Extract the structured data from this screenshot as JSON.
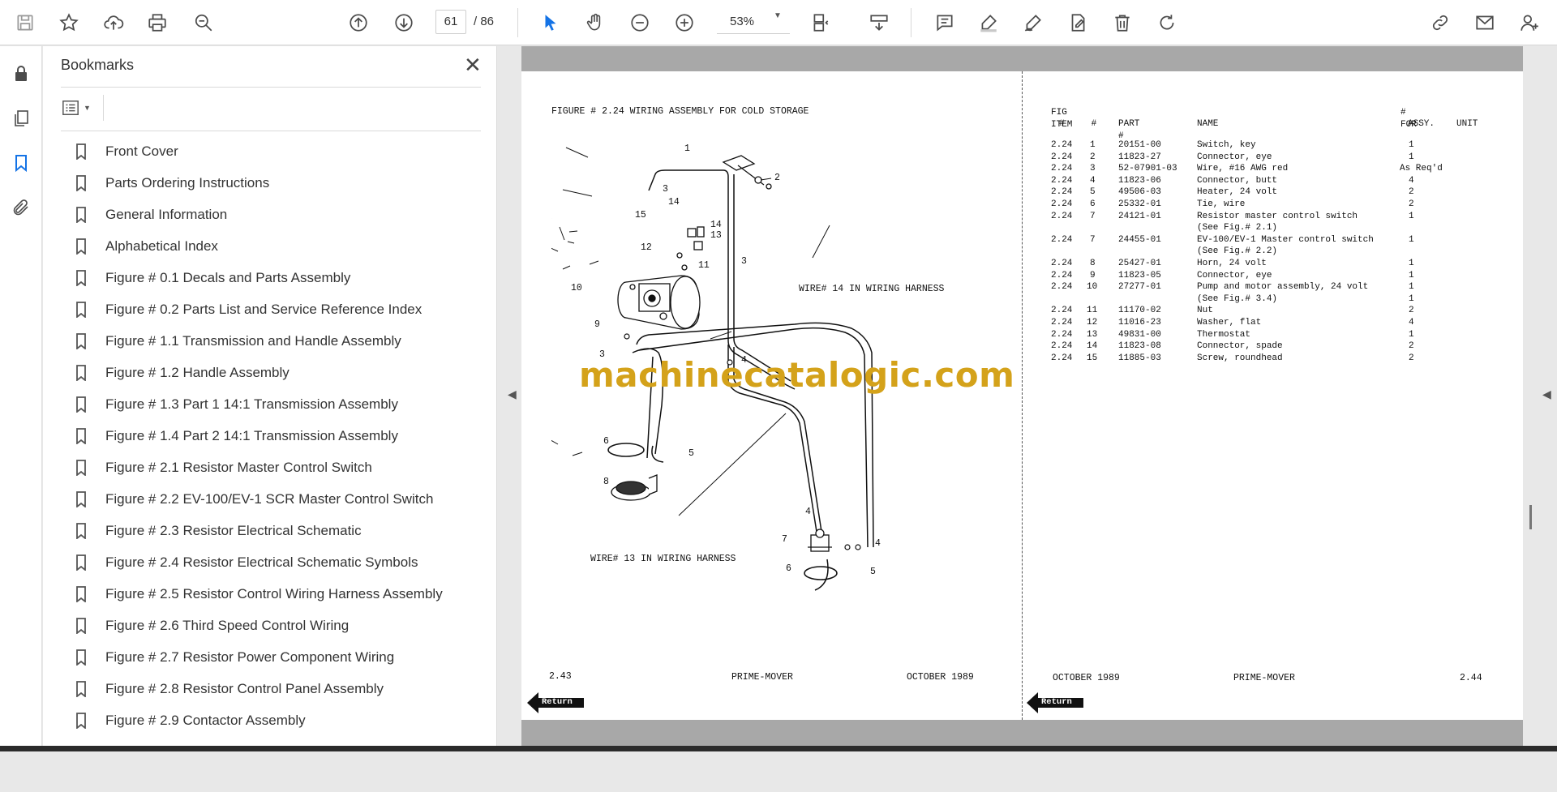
{
  "toolbar": {
    "page_current": "61",
    "page_total": "/ 86",
    "zoom": "53%"
  },
  "panel": {
    "title": "Bookmarks",
    "items": [
      {
        "label": "Front Cover"
      },
      {
        "label": "Parts Ordering Instructions"
      },
      {
        "label": "General Information"
      },
      {
        "label": "Alphabetical Index"
      },
      {
        "label": "Figure # 0.1 Decals and Parts Assembly"
      },
      {
        "label": "Figure # 0.2 Parts List and Service Reference Index"
      },
      {
        "label": "Figure # 1.1 Transmission and Handle Assembly"
      },
      {
        "label": "Figure # 1.2 Handle Assembly"
      },
      {
        "label": "Figure # 1.3 Part 1 14:1 Transmission Assembly"
      },
      {
        "label": "Figure # 1.4 Part 2 14:1 Transmission Assembly"
      },
      {
        "label": "Figure # 2.1 Resistor Master Control Switch"
      },
      {
        "label": "Figure # 2.2 EV-100/EV-1 SCR Master Control Switch"
      },
      {
        "label": "Figure # 2.3 Resistor Electrical Schematic"
      },
      {
        "label": "Figure # 2.4 Resistor Electrical Schematic Symbols"
      },
      {
        "label": "Figure # 2.5 Resistor Control Wiring Harness Assembly"
      },
      {
        "label": "Figure # 2.6 Third Speed Control Wiring"
      },
      {
        "label": "Figure # 2.7 Resistor Power Component Wiring"
      },
      {
        "label": "Figure # 2.8 Resistor Control Panel Assembly"
      },
      {
        "label": "Figure # 2.9 Contactor Assembly"
      }
    ]
  },
  "document": {
    "left_page": {
      "figure_title": "FIGURE # 2.24 WIRING ASSEMBLY FOR COLD STORAGE",
      "wire14_label": "WIRE# 14 IN WIRING HARNESS",
      "wire13_label": "WIRE# 13 IN WIRING HARNESS",
      "callouts": [
        "1",
        "2",
        "3",
        "15",
        "14",
        "14",
        "13",
        "12",
        "11",
        "3",
        "10",
        "9",
        "3",
        "4",
        "6",
        "5",
        "8",
        "4",
        "7",
        "4",
        "6",
        "5"
      ],
      "footer_left": "2.43",
      "footer_center": "PRIME-MOVER",
      "footer_right": "OCTOBER 1989",
      "return_label": "Return"
    },
    "watermark": "machinecatalogic.com",
    "right_page": {
      "headers": {
        "fig_line1": "FIG ITEM",
        "fig_line2": "#     #",
        "part": "PART #",
        "name": "NAME",
        "for_line1": "# FOR",
        "for_line2": "ASSY.",
        "unit": "UNIT"
      },
      "rows": [
        {
          "fig": "2.24",
          "item": "1",
          "part": "20151-00",
          "name": "Switch, key",
          "qty": "1"
        },
        {
          "fig": "2.24",
          "item": "2",
          "part": "11823-27",
          "name": "Connector, eye",
          "qty": "1"
        },
        {
          "fig": "2.24",
          "item": "3",
          "part": "52-07901-03",
          "name": "Wire, #16 AWG red",
          "qty": "As Req'd"
        },
        {
          "fig": "2.24",
          "item": "4",
          "part": "11823-06",
          "name": "Connector, butt",
          "qty": "4"
        },
        {
          "fig": "2.24",
          "item": "5",
          "part": "49506-03",
          "name": "Heater, 24 volt",
          "qty": "2"
        },
        {
          "fig": "2.24",
          "item": "6",
          "part": "25332-01",
          "name": "Tie, wire",
          "qty": "2"
        },
        {
          "fig": "2.24",
          "item": "7",
          "part": "24121-01",
          "name": "Resistor master control switch",
          "qty": "1"
        },
        {
          "fig": "",
          "item": "",
          "part": "",
          "name": "(See Fig.# 2.1)",
          "qty": ""
        },
        {
          "fig": "2.24",
          "item": "7",
          "part": "24455-01",
          "name": "EV-100/EV-1 Master control switch",
          "qty": "1"
        },
        {
          "fig": "",
          "item": "",
          "part": "",
          "name": "(See Fig.# 2.2)",
          "qty": ""
        },
        {
          "fig": "2.24",
          "item": "8",
          "part": "25427-01",
          "name": "Horn, 24 volt",
          "qty": "1"
        },
        {
          "fig": "2.24",
          "item": "9",
          "part": "11823-05",
          "name": "Connector, eye",
          "qty": "1"
        },
        {
          "fig": "2.24",
          "item": "10",
          "part": "27277-01",
          "name": "Pump and motor assembly, 24 volt",
          "qty": "1"
        },
        {
          "fig": "",
          "item": "",
          "part": "",
          "name": "(See Fig.# 3.4)",
          "qty": "1"
        },
        {
          "fig": "2.24",
          "item": "11",
          "part": "11170-02",
          "name": "Nut",
          "qty": "2"
        },
        {
          "fig": "2.24",
          "item": "12",
          "part": "11016-23",
          "name": "Washer, flat",
          "qty": "4"
        },
        {
          "fig": "2.24",
          "item": "13",
          "part": "49831-00",
          "name": "Thermostat",
          "qty": "1"
        },
        {
          "fig": "2.24",
          "item": "14",
          "part": "11823-08",
          "name": "Connector, spade",
          "qty": "2"
        },
        {
          "fig": "2.24",
          "item": "15",
          "part": "11885-03",
          "name": "Screw, roundhead",
          "qty": "2"
        }
      ],
      "footer_left": "OCTOBER 1989",
      "footer_center": "PRIME-MOVER",
      "footer_right": "2.44",
      "return_label": "Return"
    }
  }
}
